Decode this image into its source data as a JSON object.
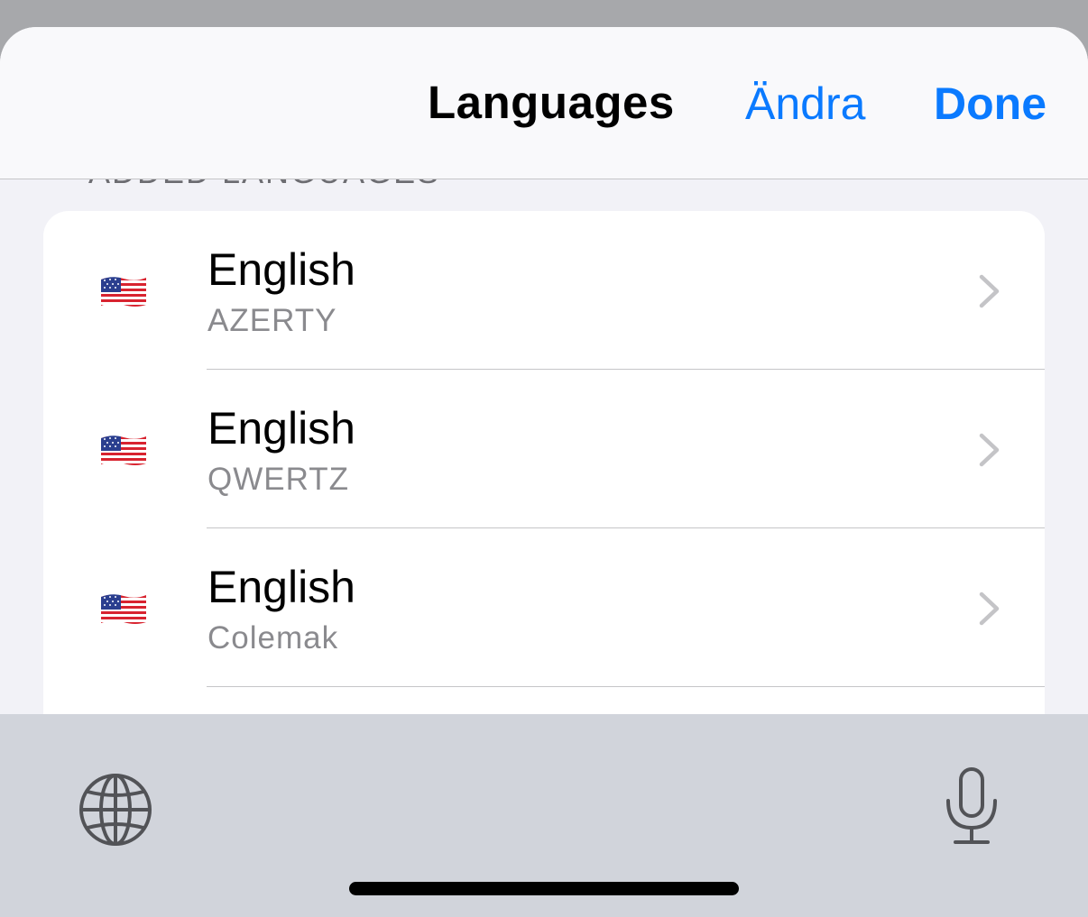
{
  "navbar": {
    "title": "Languages",
    "edit_label": "Ändra",
    "done_label": "Done"
  },
  "section": {
    "header": "ADDED LANGUAGES"
  },
  "languages": [
    {
      "name": "English",
      "layout": "AZERTY",
      "flag_icon": "us-flag-icon"
    },
    {
      "name": "English",
      "layout": "QWERTZ",
      "flag_icon": "us-flag-icon"
    },
    {
      "name": "English",
      "layout": "Colemak",
      "flag_icon": "us-flag-icon"
    }
  ],
  "keyboard_bar": {
    "left_icon": "globe-icon",
    "right_icon": "microphone-icon"
  },
  "colors": {
    "accent": "#0a7aff",
    "sheet_background": "#f2f2f7",
    "keyboard_background": "#d1d4db"
  }
}
